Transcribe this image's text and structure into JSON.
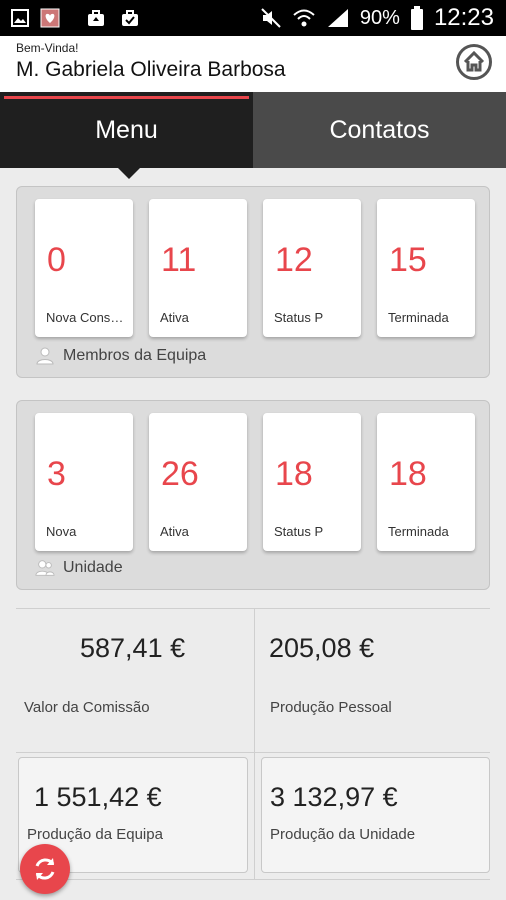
{
  "status_bar": {
    "battery": "90%",
    "time": "12:23",
    "icons": [
      "image-icon",
      "heart-icon",
      "briefcase-upload-icon",
      "briefcase-check-icon",
      "mute-icon",
      "wifi-icon",
      "signal-icon",
      "battery-icon"
    ]
  },
  "header": {
    "welcome": "Bem-Vinda!",
    "user_name": "M. Gabriela Oliveira Barbosa",
    "home_icon": "home-icon"
  },
  "tabs": [
    {
      "label": "Menu",
      "active": true
    },
    {
      "label": "Contatos",
      "active": false
    }
  ],
  "team_panel": {
    "cards": [
      {
        "value": "0",
        "label": "Nova Consul..."
      },
      {
        "value": "11",
        "label": "Ativa"
      },
      {
        "value": "12",
        "label": "Status P"
      },
      {
        "value": "15",
        "label": "Terminada"
      }
    ],
    "footer": "Membros da Equipa",
    "footer_icon": "person-icon"
  },
  "unit_panel": {
    "cards": [
      {
        "value": "3",
        "label": "Nova"
      },
      {
        "value": "26",
        "label": "Ativa"
      },
      {
        "value": "18",
        "label": "Status P"
      },
      {
        "value": "18",
        "label": "Terminada"
      }
    ],
    "footer": "Unidade",
    "footer_icon": "people-icon"
  },
  "metrics": [
    {
      "value": "587,41 €",
      "label": "Valor da Comissão"
    },
    {
      "value": "205,08 €",
      "label": "Produção Pessoal"
    },
    {
      "value": "1 551,42 €",
      "label": "Produção da Equipa"
    },
    {
      "value": "3 132,97 €",
      "label": "Produção da Unidade"
    }
  ],
  "colors": {
    "accent": "#e8464c",
    "tab_active": "#1f1f1f",
    "tab_inactive": "#4a4a4a"
  },
  "refresh_icon": "refresh-icon"
}
